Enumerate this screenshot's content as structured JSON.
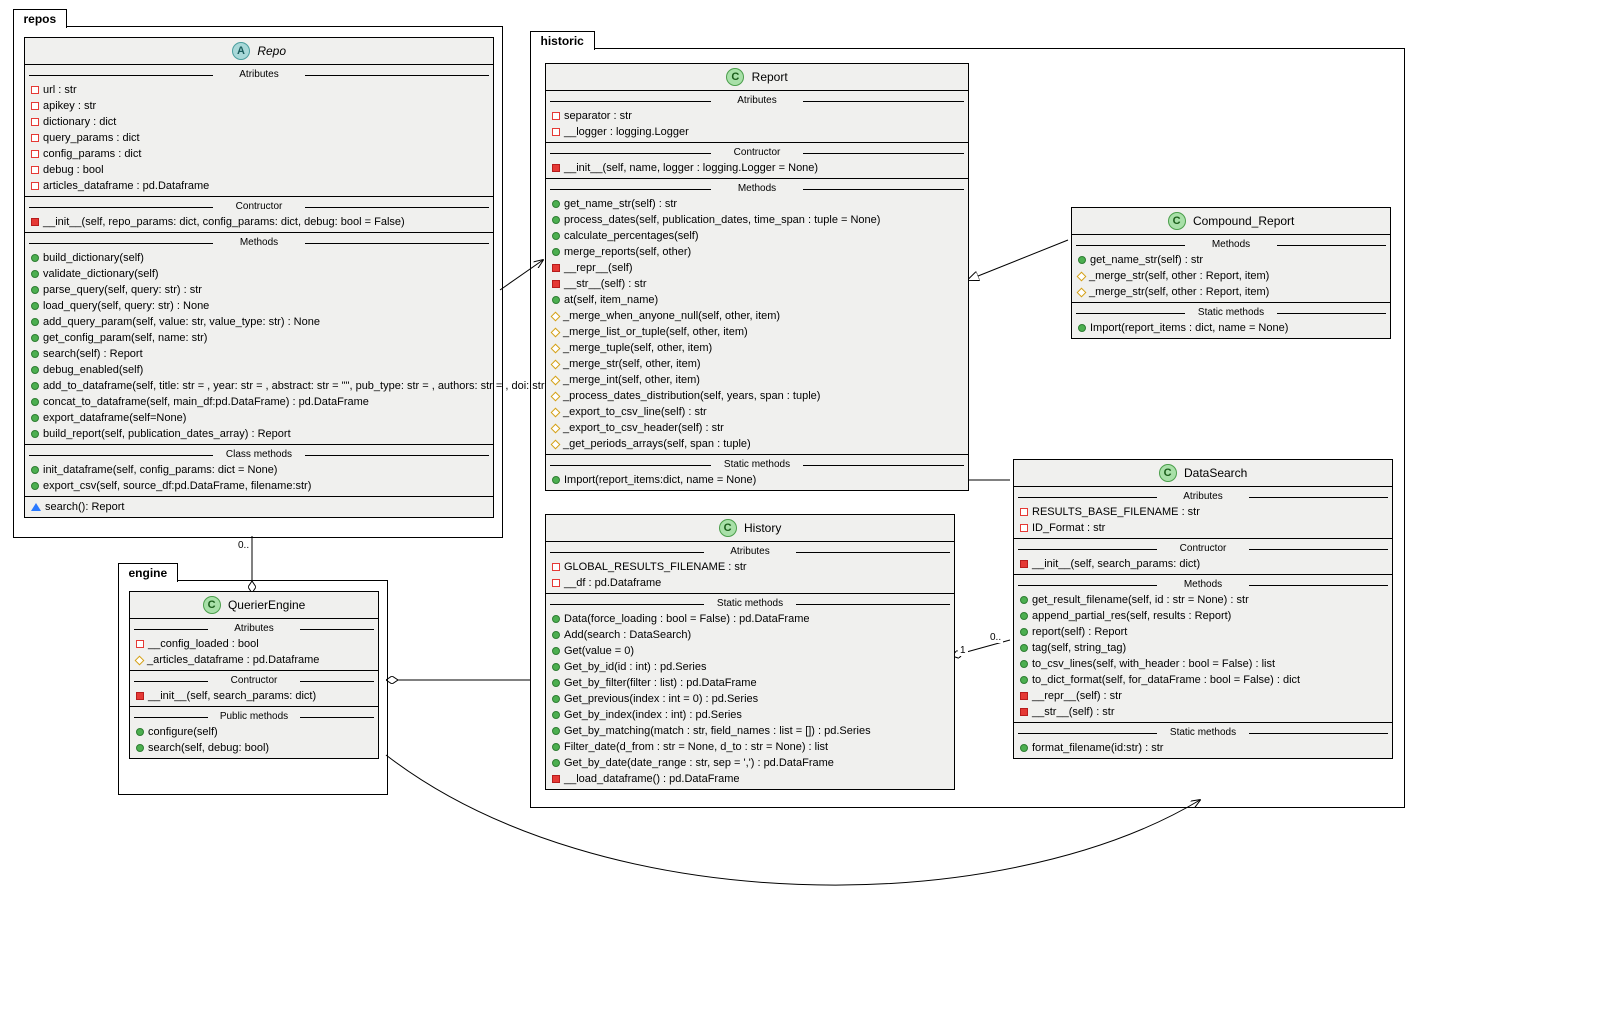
{
  "packages": {
    "repos": {
      "label": "repos"
    },
    "engine": {
      "label": "engine"
    },
    "historic": {
      "label": "historic"
    }
  },
  "classes": {
    "repo": {
      "badge": "A",
      "name": "Repo",
      "sections": [
        {
          "title": "Atributes",
          "members": [
            {
              "vis": "private-red-open-sq",
              "text": "url : str"
            },
            {
              "vis": "private-red-open-sq",
              "text": "apikey : str"
            },
            {
              "vis": "private-red-open-sq",
              "text": "dictionary : dict"
            },
            {
              "vis": "private-red-open-sq",
              "text": "query_params : dict"
            },
            {
              "vis": "private-red-open-sq",
              "text": "config_params : dict"
            },
            {
              "vis": "private-red-open-sq",
              "text": "debug : bool"
            },
            {
              "vis": "private-red-open-sq",
              "text": "articles_dataframe : pd.Dataframe"
            }
          ]
        },
        {
          "title": "Contructor",
          "members": [
            {
              "vis": "private-red-sq",
              "text": "__init__(self, repo_params: dict, config_params: dict, debug: bool = False)"
            }
          ]
        },
        {
          "title": "Methods",
          "members": [
            {
              "vis": "public-green",
              "text": "build_dictionary(self)"
            },
            {
              "vis": "public-green",
              "text": "validate_dictionary(self)"
            },
            {
              "vis": "public-green",
              "text": "parse_query(self, query: str) : str"
            },
            {
              "vis": "public-green",
              "text": "load_query(self, query: str) : None"
            },
            {
              "vis": "public-green",
              "text": "add_query_param(self, value: str, value_type: str) : None"
            },
            {
              "vis": "public-green",
              "text": "get_config_param(self, name: str)"
            },
            {
              "vis": "public-green",
              "text": "search(self) : Report"
            },
            {
              "vis": "public-green",
              "text": "debug_enabled(self)"
            },
            {
              "vis": "public-green",
              "text": "add_to_dataframe(self, title: str = ,  year: str = , abstract: str = \"\", pub_type: str = , authors: str = , doi: str = \"\")"
            },
            {
              "vis": "public-green",
              "text": "concat_to_dataframe(self, main_df:pd.DataFrame) : pd.DataFrame"
            },
            {
              "vis": "public-green",
              "text": "export_dataframe(self=None)"
            },
            {
              "vis": "public-green",
              "text": "build_report(self, publication_dates_array) : Report"
            }
          ]
        },
        {
          "title": "Class methods",
          "members": [
            {
              "vis": "public-green",
              "text": "init_dataframe(self, config_params: dict = None)"
            },
            {
              "vis": "public-green",
              "text": "export_csv(self, source_df:pd.DataFrame, filename:str)"
            }
          ]
        },
        {
          "title": "",
          "members": [
            {
              "vis": "abstract-tri",
              "text": "search(): Report"
            }
          ]
        }
      ]
    },
    "querier": {
      "badge": "C",
      "name": "QuerierEngine",
      "sections": [
        {
          "title": "Atributes",
          "members": [
            {
              "vis": "private-red-open-sq",
              "text": "__config_loaded : bool"
            },
            {
              "vis": "protected-yellow",
              "text": "_articles_dataframe : pd.Dataframe"
            }
          ]
        },
        {
          "title": "Contructor",
          "members": [
            {
              "vis": "private-red-sq",
              "text": "__init__(self, search_params: dict)"
            }
          ]
        },
        {
          "title": "Public methods",
          "members": [
            {
              "vis": "public-green",
              "text": "configure(self)"
            },
            {
              "vis": "public-green",
              "text": "search(self, debug: bool)"
            }
          ]
        }
      ]
    },
    "report": {
      "badge": "C",
      "name": "Report",
      "sections": [
        {
          "title": "Atributes",
          "members": [
            {
              "vis": "private-red-open-sq",
              "text": "separator : str"
            },
            {
              "vis": "private-red-open-sq",
              "text": "__logger : logging.Logger"
            }
          ]
        },
        {
          "title": "Contructor",
          "members": [
            {
              "vis": "private-red-sq",
              "text": "__init__(self, name, logger : logging.Logger = None)"
            }
          ]
        },
        {
          "title": "Methods",
          "members": [
            {
              "vis": "public-green",
              "text": "get_name_str(self) : str"
            },
            {
              "vis": "public-green",
              "text": "process_dates(self, publication_dates, time_span : tuple = None)"
            },
            {
              "vis": "public-green",
              "text": "calculate_percentages(self)"
            },
            {
              "vis": "public-green",
              "text": "merge_reports(self, other)"
            },
            {
              "vis": "private-red-sq",
              "text": "__repr__(self)"
            },
            {
              "vis": "private-red-sq",
              "text": "__str__(self) : str"
            },
            {
              "vis": "public-green",
              "text": "at(self, item_name)"
            },
            {
              "vis": "protected-yellow",
              "text": "_merge_when_anyone_null(self, other, item)"
            },
            {
              "vis": "protected-yellow",
              "text": "_merge_list_or_tuple(self, other, item)"
            },
            {
              "vis": "protected-yellow",
              "text": "_merge_tuple(self, other, item)"
            },
            {
              "vis": "protected-yellow",
              "text": "_merge_str(self, other, item)"
            },
            {
              "vis": "protected-yellow",
              "text": "_merge_int(self, other, item)"
            },
            {
              "vis": "protected-yellow",
              "text": "_process_dates_distribution(self, years, span : tuple)"
            },
            {
              "vis": "protected-yellow",
              "text": "_export_to_csv_line(self) : str"
            },
            {
              "vis": "protected-yellow",
              "text": "_export_to_csv_header(self) : str"
            },
            {
              "vis": "protected-yellow",
              "text": "_get_periods_arrays(self, span : tuple)"
            }
          ]
        },
        {
          "title": "Static methods",
          "members": [
            {
              "vis": "public-green",
              "text": "Import(report_items:dict, name = None)"
            }
          ]
        }
      ]
    },
    "compound": {
      "badge": "C",
      "name": "Compound_Report",
      "sections": [
        {
          "title": "Methods",
          "members": [
            {
              "vis": "public-green",
              "text": "get_name_str(self) : str"
            },
            {
              "vis": "protected-yellow",
              "text": "_merge_str(self, other : Report, item)"
            },
            {
              "vis": "protected-yellow",
              "text": "_merge_str(self, other : Report, item)"
            }
          ]
        },
        {
          "title": "Static methods",
          "members": [
            {
              "vis": "public-green",
              "text": "Import(report_items : dict, name = None)"
            }
          ]
        }
      ]
    },
    "history": {
      "badge": "C",
      "name": "History",
      "sections": [
        {
          "title": "Atributes",
          "members": [
            {
              "vis": "private-red-open-sq",
              "text": "GLOBAL_RESULTS_FILENAME : str"
            },
            {
              "vis": "private-red-open-sq",
              "text": "__df : pd.Dataframe"
            }
          ]
        },
        {
          "title": "Static methods",
          "members": [
            {
              "vis": "public-green",
              "text": "Data(force_loading : bool = False) : pd.DataFrame"
            },
            {
              "vis": "public-green",
              "text": "Add(search : DataSearch)"
            },
            {
              "vis": "public-green",
              "text": "Get(value = 0)"
            },
            {
              "vis": "public-green",
              "text": "Get_by_id(id : int) : pd.Series"
            },
            {
              "vis": "public-green",
              "text": "Get_by_filter(filter : list) : pd.DataFrame"
            },
            {
              "vis": "public-green",
              "text": "Get_previous(index : int = 0) : pd.Series"
            },
            {
              "vis": "public-green",
              "text": "Get_by_index(index : int) : pd.Series"
            },
            {
              "vis": "public-green",
              "text": "Get_by_matching(match : str, field_names : list = []) : pd.Series"
            },
            {
              "vis": "public-green",
              "text": "Filter_date(d_from : str = None, d_to : str = None) : list"
            },
            {
              "vis": "public-green",
              "text": "Get_by_date(date_range : str, sep = ',') : pd.DataFrame"
            },
            {
              "vis": "private-red-sq",
              "text": "__load_dataframe() : pd.DataFrame"
            }
          ]
        }
      ]
    },
    "datasearch": {
      "badge": "C",
      "name": "DataSearch",
      "sections": [
        {
          "title": "Atributes",
          "members": [
            {
              "vis": "private-red-open-sq",
              "text": "RESULTS_BASE_FILENAME : str"
            },
            {
              "vis": "private-red-open-sq",
              "text": "ID_Format : str"
            }
          ]
        },
        {
          "title": "Contructor",
          "members": [
            {
              "vis": "private-red-sq",
              "text": "__init__(self, search_params: dict)"
            }
          ]
        },
        {
          "title": "Methods",
          "members": [
            {
              "vis": "public-green",
              "text": "get_result_filename(self, id : str = None) : str"
            },
            {
              "vis": "public-green",
              "text": "append_partial_res(self, results : Report)"
            },
            {
              "vis": "public-green",
              "text": "report(self) : Report"
            },
            {
              "vis": "public-green",
              "text": "tag(self, string_tag)"
            },
            {
              "vis": "public-green",
              "text": "to_csv_lines(self, with_header : bool = False) : list"
            },
            {
              "vis": "public-green",
              "text": "to_dict_format(self, for_dataFrame : bool = False) : dict"
            },
            {
              "vis": "private-red-sq",
              "text": "__repr__(self) : str"
            },
            {
              "vis": "private-red-sq",
              "text": "__str__(self) : str"
            }
          ]
        },
        {
          "title": "Static methods",
          "members": [
            {
              "vis": "public-green",
              "text": "format_filename(id:str) : str"
            }
          ]
        }
      ]
    }
  },
  "cardinalities": {
    "repo_querier": "0..",
    "history_datasearch_left": "1",
    "history_datasearch_right": "0.."
  }
}
